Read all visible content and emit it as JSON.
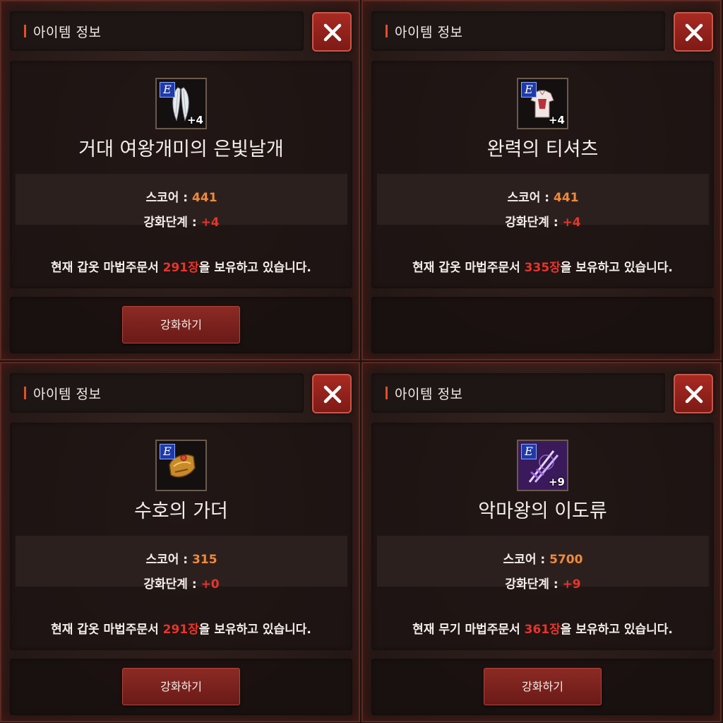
{
  "colors": {
    "accent": "#e0502a",
    "score": "#f08a3a",
    "enhance": "#e8342a",
    "close_button": "#a82a22"
  },
  "panels": [
    {
      "title": "아이템 정보",
      "close_icon": "close-icon",
      "item": {
        "grade": "E",
        "level": "+4",
        "name": "거대 여왕개미의 은빛날개",
        "icon": "silver-wings-icon"
      },
      "score_label": "스코어 : ",
      "score": "441",
      "enhance_label": "강화단계 : ",
      "enhance": "+4",
      "scroll_prefix": "현재 갑옷 마법주문서 ",
      "scroll_count": "291장",
      "scroll_suffix": "을 보유하고 있습니다.",
      "button_label": "강화하기"
    },
    {
      "title": "아이템 정보",
      "close_icon": "close-icon",
      "item": {
        "grade": "E",
        "level": "+4",
        "name": "완력의 티셔츠",
        "icon": "tshirt-icon"
      },
      "score_label": "스코어 : ",
      "score": "441",
      "enhance_label": "강화단계 : ",
      "enhance": "+4",
      "scroll_prefix": "현재 갑옷 마법주문서 ",
      "scroll_count": "335장",
      "scroll_suffix": "을 보유하고 있습니다.",
      "button_label": ""
    },
    {
      "title": "아이템 정보",
      "close_icon": "close-icon",
      "item": {
        "grade": "E",
        "level": "",
        "name": "수호의 가더",
        "icon": "guarder-icon"
      },
      "score_label": "스코어 : ",
      "score": "315",
      "enhance_label": "강화단계 : ",
      "enhance": "+0",
      "scroll_prefix": "현재 갑옷 마법주문서 ",
      "scroll_count": "291장",
      "scroll_suffix": "을 보유하고 있습니다.",
      "button_label": "강화하기"
    },
    {
      "title": "아이템 정보",
      "close_icon": "close-icon",
      "item": {
        "grade": "E",
        "level": "+9",
        "name": "악마왕의 이도류",
        "icon": "dual-blades-icon"
      },
      "score_label": "스코어 : ",
      "score": "5700",
      "enhance_label": "강화단계 : ",
      "enhance": "+9",
      "scroll_prefix": "현재 무기 마법주문서 ",
      "scroll_count": "361장",
      "scroll_suffix": "을 보유하고 있습니다.",
      "button_label": "강화하기"
    }
  ]
}
